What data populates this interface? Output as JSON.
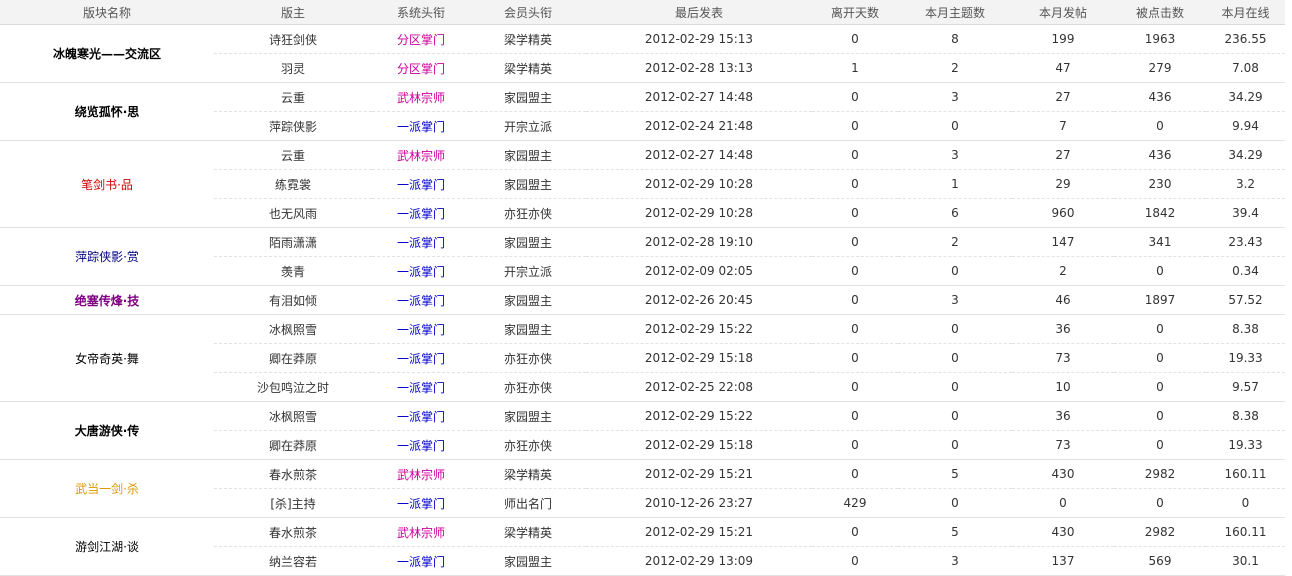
{
  "columns": [
    "版块名称",
    "版主",
    "系统头衔",
    "会员头衔",
    "最后发表",
    "离开天数",
    "本月主题数",
    "本月发帖",
    "被点击数",
    "本月在线"
  ],
  "colors": {
    "title_pink": "#cc0099",
    "title_blue": "#0000cc",
    "board_black": "#000000",
    "board_red": "#cc0000",
    "board_navy": "#000080",
    "board_purple": "#800080",
    "board_orange": "#dd9900"
  },
  "boards": [
    {
      "name": "冰魄寒光——交流区",
      "color": "#000000",
      "bold": true,
      "rows": [
        {
          "moderator": "诗狂剑侠",
          "sys_title": "分区掌门",
          "sys_color": "#cc0099",
          "member_title": "梁学精英",
          "last_post": "2012-02-29 15:13",
          "days_away": "0",
          "topics": "8",
          "posts": "199",
          "clicks": "1963",
          "online": "236.55"
        },
        {
          "moderator": "羽灵",
          "sys_title": "分区掌门",
          "sys_color": "#cc0099",
          "member_title": "梁学精英",
          "last_post": "2012-02-28 13:13",
          "days_away": "1",
          "topics": "2",
          "posts": "47",
          "clicks": "279",
          "online": "7.08"
        }
      ]
    },
    {
      "name": "绕览孤怀·思",
      "color": "#000000",
      "bold": true,
      "rows": [
        {
          "moderator": "云重",
          "sys_title": "武林宗师",
          "sys_color": "#cc0099",
          "member_title": "家园盟主",
          "last_post": "2012-02-27 14:48",
          "days_away": "0",
          "topics": "3",
          "posts": "27",
          "clicks": "436",
          "online": "34.29"
        },
        {
          "moderator": "萍踪侠影",
          "sys_title": "一派掌门",
          "sys_color": "#0000cc",
          "member_title": "开宗立派",
          "last_post": "2012-02-24 21:48",
          "days_away": "0",
          "topics": "0",
          "posts": "7",
          "clicks": "0",
          "online": "9.94"
        }
      ]
    },
    {
      "name": "笔剑书·品",
      "color": "#cc0000",
      "bold": false,
      "rows": [
        {
          "moderator": "云重",
          "sys_title": "武林宗师",
          "sys_color": "#cc0099",
          "member_title": "家园盟主",
          "last_post": "2012-02-27 14:48",
          "days_away": "0",
          "topics": "3",
          "posts": "27",
          "clicks": "436",
          "online": "34.29"
        },
        {
          "moderator": "练霓裳",
          "sys_title": "一派掌门",
          "sys_color": "#0000cc",
          "member_title": "家园盟主",
          "last_post": "2012-02-29 10:28",
          "days_away": "0",
          "topics": "1",
          "posts": "29",
          "clicks": "230",
          "online": "3.2"
        },
        {
          "moderator": "也无风雨",
          "sys_title": "一派掌门",
          "sys_color": "#0000cc",
          "member_title": "亦狂亦侠",
          "last_post": "2012-02-29 10:28",
          "days_away": "0",
          "topics": "6",
          "posts": "960",
          "clicks": "1842",
          "online": "39.4"
        }
      ]
    },
    {
      "name": "萍踪侠影·赏",
      "color": "#000080",
      "bold": false,
      "rows": [
        {
          "moderator": "陌雨潇潇",
          "sys_title": "一派掌门",
          "sys_color": "#0000cc",
          "member_title": "家园盟主",
          "last_post": "2012-02-28 19:10",
          "days_away": "0",
          "topics": "2",
          "posts": "147",
          "clicks": "341",
          "online": "23.43"
        },
        {
          "moderator": "羡青",
          "sys_title": "一派掌门",
          "sys_color": "#0000cc",
          "member_title": "开宗立派",
          "last_post": "2012-02-09 02:05",
          "days_away": "0",
          "topics": "0",
          "posts": "2",
          "clicks": "0",
          "online": "0.34"
        }
      ]
    },
    {
      "name": "绝塞传烽·技",
      "color": "#800080",
      "bold": true,
      "rows": [
        {
          "moderator": "有泪如倾",
          "sys_title": "一派掌门",
          "sys_color": "#0000cc",
          "member_title": "家园盟主",
          "last_post": "2012-02-26 20:45",
          "days_away": "0",
          "topics": "3",
          "posts": "46",
          "clicks": "1897",
          "online": "57.52"
        }
      ]
    },
    {
      "name": "女帝奇英·舞",
      "color": "#000000",
      "bold": false,
      "rows": [
        {
          "moderator": "冰枫照雪",
          "sys_title": "一派掌门",
          "sys_color": "#0000cc",
          "member_title": "家园盟主",
          "last_post": "2012-02-29 15:22",
          "days_away": "0",
          "topics": "0",
          "posts": "36",
          "clicks": "0",
          "online": "8.38"
        },
        {
          "moderator": "卿在莽原",
          "sys_title": "一派掌门",
          "sys_color": "#0000cc",
          "member_title": "亦狂亦侠",
          "last_post": "2012-02-29 15:18",
          "days_away": "0",
          "topics": "0",
          "posts": "73",
          "clicks": "0",
          "online": "19.33"
        },
        {
          "moderator": "沙包鸣泣之时",
          "sys_title": "一派掌门",
          "sys_color": "#0000cc",
          "member_title": "亦狂亦侠",
          "last_post": "2012-02-25 22:08",
          "days_away": "0",
          "topics": "0",
          "posts": "10",
          "clicks": "0",
          "online": "9.57"
        }
      ]
    },
    {
      "name": "大唐游侠·传",
      "color": "#000000",
      "bold": true,
      "rows": [
        {
          "moderator": "冰枫照雪",
          "sys_title": "一派掌门",
          "sys_color": "#0000cc",
          "member_title": "家园盟主",
          "last_post": "2012-02-29 15:22",
          "days_away": "0",
          "topics": "0",
          "posts": "36",
          "clicks": "0",
          "online": "8.38"
        },
        {
          "moderator": "卿在莽原",
          "sys_title": "一派掌门",
          "sys_color": "#0000cc",
          "member_title": "亦狂亦侠",
          "last_post": "2012-02-29 15:18",
          "days_away": "0",
          "topics": "0",
          "posts": "73",
          "clicks": "0",
          "online": "19.33"
        }
      ]
    },
    {
      "name": "武当一剑·杀",
      "color": "#dd9900",
      "bold": false,
      "rows": [
        {
          "moderator": "春水煎茶",
          "sys_title": "武林宗师",
          "sys_color": "#cc0099",
          "member_title": "梁学精英",
          "last_post": "2012-02-29 15:21",
          "days_away": "0",
          "topics": "5",
          "posts": "430",
          "clicks": "2982",
          "online": "160.11"
        },
        {
          "moderator": "[杀]主持",
          "sys_title": "一派掌门",
          "sys_color": "#0000cc",
          "member_title": "师出名门",
          "last_post": "2010-12-26 23:27",
          "days_away": "429",
          "topics": "0",
          "posts": "0",
          "clicks": "0",
          "online": "0"
        }
      ]
    },
    {
      "name": "游剑江湖·谈",
      "color": "#000000",
      "bold": false,
      "rows": [
        {
          "moderator": "春水煎茶",
          "sys_title": "武林宗师",
          "sys_color": "#cc0099",
          "member_title": "梁学精英",
          "last_post": "2012-02-29 15:21",
          "days_away": "0",
          "topics": "5",
          "posts": "430",
          "clicks": "2982",
          "online": "160.11"
        },
        {
          "moderator": "纳兰容若",
          "sys_title": "一派掌门",
          "sys_color": "#0000cc",
          "member_title": "家园盟主",
          "last_post": "2012-02-29 13:09",
          "days_away": "0",
          "topics": "3",
          "posts": "137",
          "clicks": "569",
          "online": "30.1"
        }
      ]
    }
  ]
}
